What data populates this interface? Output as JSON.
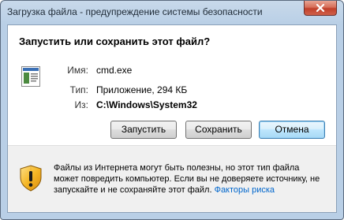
{
  "window": {
    "title": "Загрузка файла - предупреждение системы безопасности"
  },
  "dialog": {
    "heading": "Запустить или сохранить этот файл?",
    "file": {
      "name_label": "Имя:",
      "name_value": "cmd.exe",
      "type_label": "Тип:",
      "type_value": "Приложение, 294 КБ",
      "from_label": "Из:",
      "from_value": "C:\\Windows\\System32"
    },
    "buttons": {
      "run": "Запустить",
      "save": "Сохранить",
      "cancel": "Отмена"
    },
    "warning": {
      "line1": "Файлы из Интернета могут быть полезны, но этот тип файла",
      "line2": "может повредить компьютер. Если вы не доверяете источнику, не",
      "line3_prefix": "запускайте и не сохраняйте этот файл. ",
      "risk_link": "Факторы риска"
    }
  },
  "icons": {
    "close": "close-icon",
    "file": "application-file-icon",
    "warning": "shield-warning-icon"
  },
  "colors": {
    "titlebar": "#b9cfe6",
    "link": "#0066cc",
    "default_button": "#bee6fd",
    "close_button": "#c0402a"
  }
}
